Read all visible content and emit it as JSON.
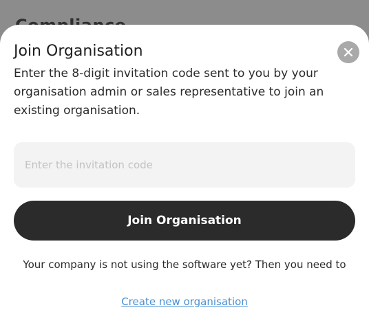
{
  "backdrop": {
    "title": "Compliance"
  },
  "dialog": {
    "title": "Join Organisation",
    "close_icon": "close-icon",
    "description": "Enter the 8-digit invitation code sent to you by your organisation admin or sales representative to join an existing organisation.",
    "code_input": {
      "value": "",
      "placeholder": "Enter the invitation code"
    },
    "join_button_label": "Join Organisation",
    "footer_text": "Your company is not using the software yet? Then you need to",
    "create_link_label": "Create new organisation"
  },
  "colors": {
    "primary_button": "#2b2b2b",
    "link": "#4b8fd1",
    "close_button": "#a9a9a9",
    "input_background": "#f3f3f3",
    "backdrop": "#8c8c8c"
  }
}
